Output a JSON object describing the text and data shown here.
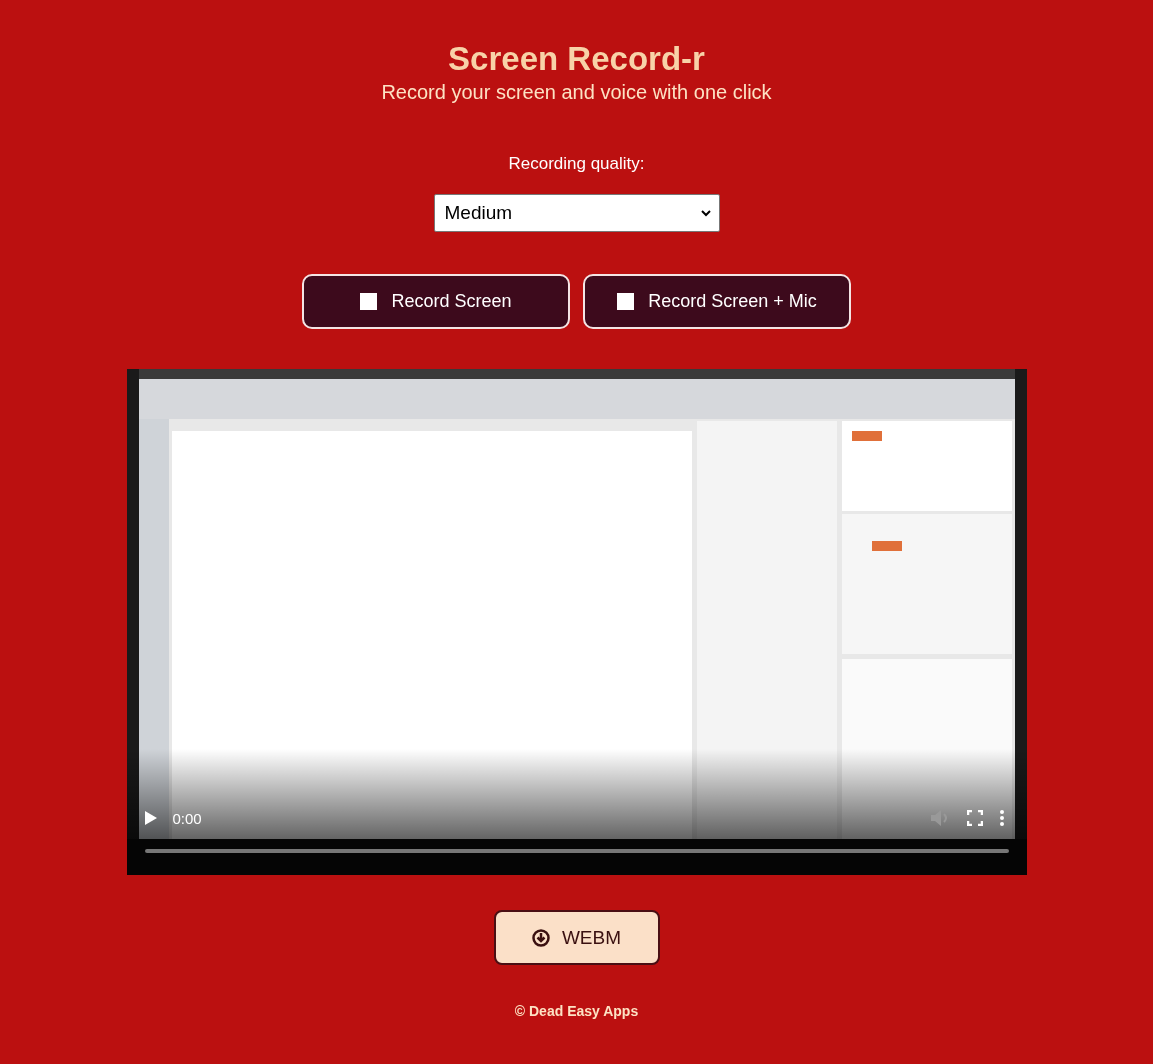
{
  "header": {
    "title": "Screen Record-r",
    "subtitle": "Record your screen and voice with one click"
  },
  "quality": {
    "label": "Recording quality:",
    "value": "Medium"
  },
  "record_buttons": [
    {
      "label": "Record Screen"
    },
    {
      "label": "Record Screen + Mic"
    }
  ],
  "video": {
    "time": "0:00"
  },
  "download_button": {
    "label": "WEBM"
  },
  "footer": "© Dead Easy Apps"
}
